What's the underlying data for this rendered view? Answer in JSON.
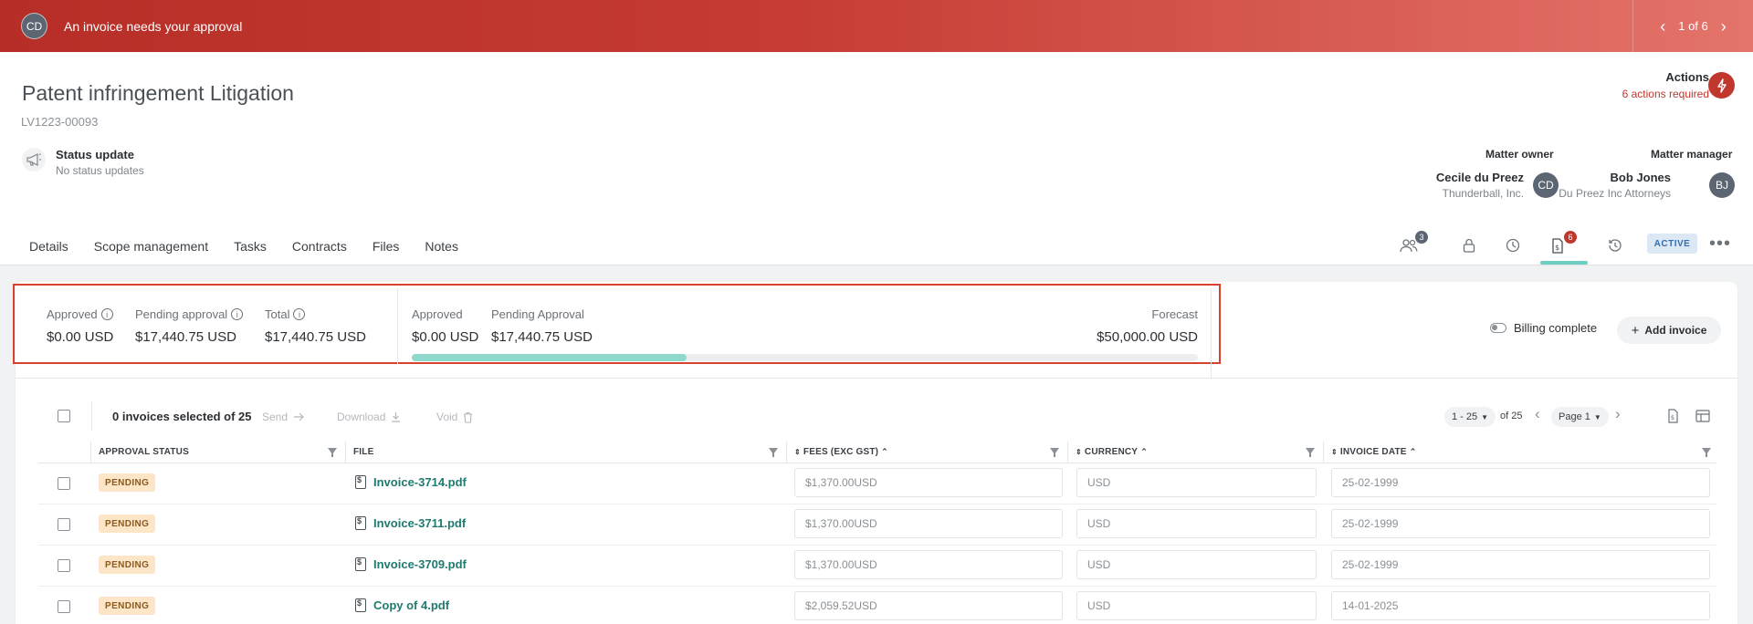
{
  "banner": {
    "avatar_initials": "CD",
    "message": "An invoice needs your approval",
    "pager_text": "1 of 6"
  },
  "header": {
    "title": "Patent infringement Litigation",
    "matter_id": "LV1223-00093",
    "status_title": "Status update",
    "status_sub": "No status updates",
    "actions_label": "Actions",
    "actions_required": "6 actions required"
  },
  "people": {
    "owner_label": "Matter owner",
    "owner_name": "Cecile du Preez",
    "owner_org": "Thunderball, Inc.",
    "owner_initials": "CD",
    "manager_label": "Matter manager",
    "manager_name": "Bob Jones",
    "manager_org": "Du Preez Inc Attorneys",
    "manager_initials": "BJ"
  },
  "tabs": [
    "Details",
    "Scope management",
    "Tasks",
    "Contracts",
    "Files",
    "Notes"
  ],
  "tab_icons": {
    "people_count": "3",
    "invoice_count": "6",
    "status_badge": "ACTIVE"
  },
  "summary": {
    "approved_label": "Approved",
    "approved_value": "$0.00 USD",
    "pending_label": "Pending approval",
    "pending_value": "$17,440.75 USD",
    "total_label": "Total",
    "total_value": "$17,440.75 USD",
    "budget_approved_label": "Approved",
    "budget_approved_value": "$0.00 USD",
    "budget_pending_label": "Pending Approval",
    "budget_pending_value": "$17,440.75 USD",
    "forecast_label": "Forecast",
    "forecast_value": "$50,000.00 USD",
    "progress_fraction": 0.35
  },
  "billing": {
    "billing_complete_label": "Billing complete",
    "add_invoice_label": "Add invoice"
  },
  "toolbar": {
    "selected_text": "0 invoices selected of 25",
    "send_label": "Send",
    "download_label": "Download",
    "void_label": "Void",
    "range_label": "1 - 25",
    "of_label": "of 25",
    "page_label": "Page 1"
  },
  "table": {
    "headers": {
      "approval_status": "APPROVAL STATUS",
      "file": "FILE",
      "fees": "FEES (EXC GST)",
      "currency": "CURRENCY",
      "invoice_date": "INVOICE DATE"
    },
    "rows": [
      {
        "status": "PENDING",
        "file": "Invoice-3714.pdf",
        "fees": "$1,370.00USD",
        "currency": "USD",
        "date": "25-02-1999"
      },
      {
        "status": "PENDING",
        "file": "Invoice-3711.pdf",
        "fees": "$1,370.00USD",
        "currency": "USD",
        "date": "25-02-1999"
      },
      {
        "status": "PENDING",
        "file": "Invoice-3709.pdf",
        "fees": "$1,370.00USD",
        "currency": "USD",
        "date": "25-02-1999"
      },
      {
        "status": "PENDING",
        "file": "Copy of 4.pdf",
        "fees": "$2,059.52USD",
        "currency": "USD",
        "date": "14-01-2025"
      }
    ]
  },
  "colors": {
    "brand_red": "#c0372e",
    "accent_teal": "#6ccfc1",
    "pending_badge": "#fde5c8",
    "link_teal": "#1f7a6f"
  }
}
